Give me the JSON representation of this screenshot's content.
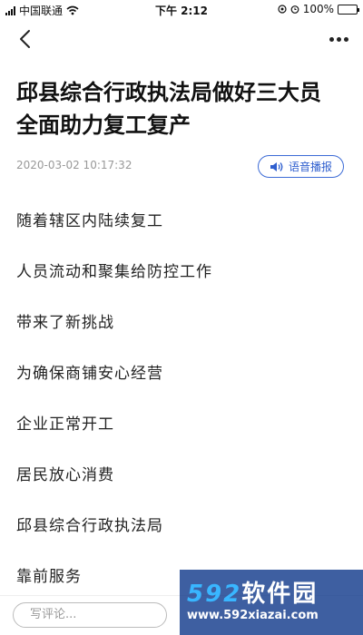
{
  "status_bar": {
    "carrier": "中国联通",
    "time": "下午 2:12",
    "battery_percent": "100%",
    "battery_level": 1.0,
    "battery_color": "#4cd964"
  },
  "nav": {
    "back_icon": "chevron-left-icon",
    "more_icon": "more-dots-icon"
  },
  "article": {
    "title_lines": [
      "邱县综合行政执法局做好三大员",
      "全面助力复工复产"
    ],
    "date": "2020-03-02 10:17:32",
    "audio_button_label": "语音播报",
    "audio_icon": "speaker-icon",
    "accent_color": "#3c6bd6",
    "paragraphs": [
      "随着辖区内陆续复工",
      "人员流动和聚集给防控工作",
      "带来了新挑战",
      "为确保商铺安心经营",
      "企业正常开工",
      "居民放心消费",
      "邱县综合行政执法局",
      "靠前服务"
    ]
  },
  "bottom_bar": {
    "comment_placeholder": "写评论..."
  },
  "watermark": {
    "logo_number": "592",
    "logo_text": "软件园",
    "url": "www.592xiazai.com"
  }
}
